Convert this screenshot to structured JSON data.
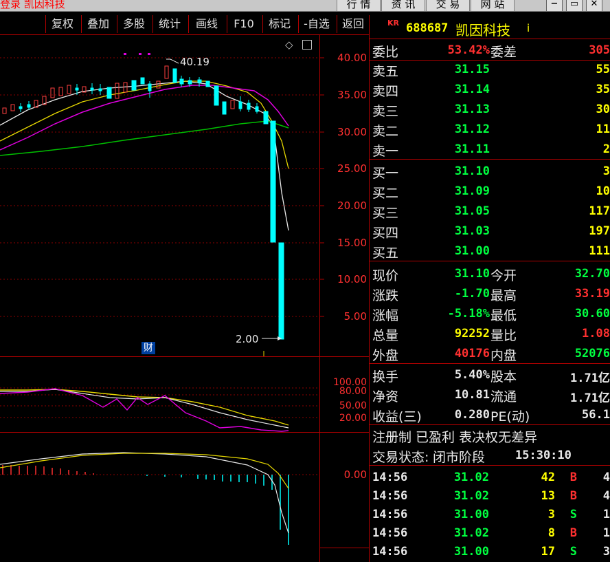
{
  "topbar": {
    "title": "登录 凯因科技",
    "nav": [
      "行 情",
      "资 讯",
      "交 易",
      "网 站"
    ],
    "win_buttons": [
      "minimize-icon",
      "restore-icon",
      "close-icon"
    ]
  },
  "toolbar": {
    "items": [
      "复权",
      "叠加",
      "多股",
      "统计",
      "画线",
      "F10",
      "标记",
      "-自选",
      "返回"
    ]
  },
  "stock": {
    "market": "KR",
    "code": "688687",
    "name": "凯因科技",
    "info_mark": "i"
  },
  "price_axis": [
    "40.00",
    "35.00",
    "30.00",
    "25.00",
    "20.00",
    "15.00",
    "10.00",
    "5.00"
  ],
  "annotations": {
    "high": "40.19",
    "low": "2.00",
    "event": "财"
  },
  "kdj_axis": [
    "100.00",
    "80.00",
    "50.00",
    "20.00"
  ],
  "macd_axis": [
    "0.00"
  ],
  "order_book": {
    "weibi_label": "委比",
    "weibi": "53.42%",
    "weicha_label": "委差",
    "weicha": "305",
    "asks": [
      {
        "label": "卖五",
        "price": "31.15",
        "vol": "55"
      },
      {
        "label": "卖四",
        "price": "31.14",
        "vol": "35"
      },
      {
        "label": "卖三",
        "price": "31.13",
        "vol": "30"
      },
      {
        "label": "卖二",
        "price": "31.12",
        "vol": "11"
      },
      {
        "label": "卖一",
        "price": "31.11",
        "vol": "2"
      }
    ],
    "bids": [
      {
        "label": "买一",
        "price": "31.10",
        "vol": "3"
      },
      {
        "label": "买二",
        "price": "31.09",
        "vol": "10"
      },
      {
        "label": "买三",
        "price": "31.05",
        "vol": "117"
      },
      {
        "label": "买四",
        "price": "31.03",
        "vol": "197"
      },
      {
        "label": "买五",
        "price": "31.00",
        "vol": "111"
      }
    ]
  },
  "quote": [
    {
      "l1": "现价",
      "v1": "31.10",
      "l2": "今开",
      "v2": "32.70"
    },
    {
      "l1": "涨跌",
      "v1": "-1.70",
      "l2": "最高",
      "v2": "33.19"
    },
    {
      "l1": "涨幅",
      "v1": "-5.18%",
      "l2": "最低",
      "v2": "30.60"
    },
    {
      "l1": "总量",
      "v1": "92252",
      "l2": "量比",
      "v2": "1.08"
    },
    {
      "l1": "外盘",
      "v1": "40176",
      "l2": "内盘",
      "v2": "52076"
    }
  ],
  "fundamentals": [
    {
      "l1": "换手",
      "v1": "5.40%",
      "l2": "股本",
      "v2": "1.71亿"
    },
    {
      "l1": "净资",
      "v1": "10.81",
      "l2": "流通",
      "v2": "1.71亿"
    },
    {
      "l1": "收益(三)",
      "v1": "0.280",
      "l2": "PE(动)",
      "v2": "56.1"
    }
  ],
  "notes": {
    "reg": "注册制 已盈利 表决权无差异",
    "status_label": "交易状态:",
    "status": "闭市阶段",
    "time": "15:30:10"
  },
  "ticks": [
    {
      "t": "14:56",
      "p": "31.02",
      "v": "42",
      "d": "B",
      "n": "4"
    },
    {
      "t": "14:56",
      "p": "31.02",
      "v": "13",
      "d": "B",
      "n": "4"
    },
    {
      "t": "14:56",
      "p": "31.00",
      "v": "3",
      "d": "S",
      "n": "1"
    },
    {
      "t": "14:56",
      "p": "31.02",
      "v": "8",
      "d": "B",
      "n": "1"
    },
    {
      "t": "14:56",
      "p": "31.00",
      "v": "17",
      "d": "S",
      "n": "3"
    }
  ]
}
